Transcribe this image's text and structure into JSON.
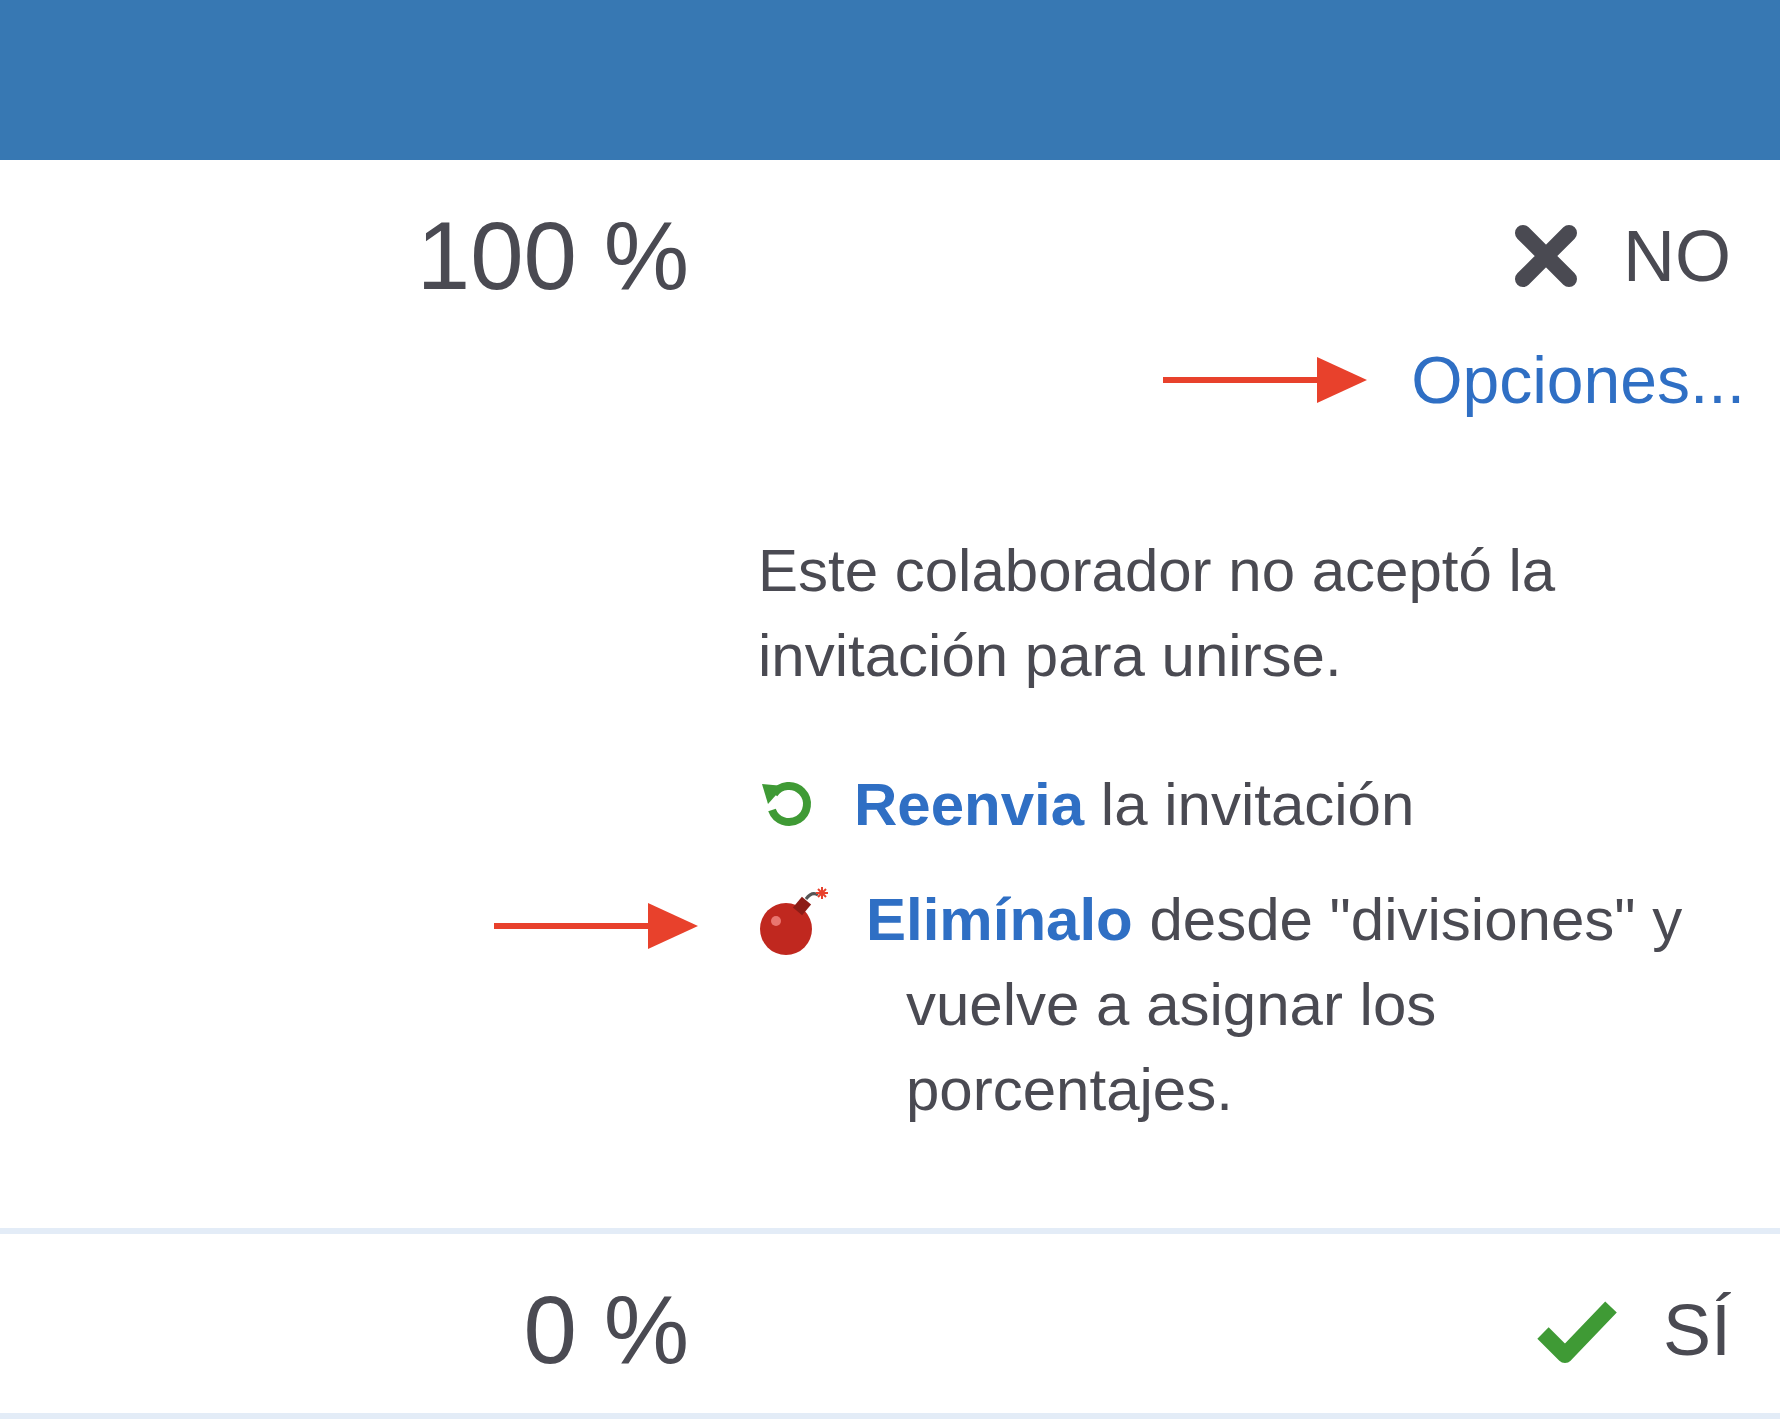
{
  "rows": [
    {
      "percent": "100 %",
      "status": {
        "kind": "no",
        "label": "NO"
      },
      "options": {
        "label": "Opciones...",
        "marked": true
      },
      "note": "Este colaborador no aceptó la invitación para unirse.",
      "actions": [
        {
          "kind": "resend",
          "link": "Reenvia",
          "text": "la invitación",
          "marked": false
        },
        {
          "kind": "remove",
          "link": "Elimínalo",
          "text": "desde \"divisiones\" y vuelve a asignar los porcentajes.",
          "marked": true
        }
      ]
    },
    {
      "percent": "0 %",
      "status": {
        "kind": "yes",
        "label": "SÍ"
      }
    }
  ]
}
